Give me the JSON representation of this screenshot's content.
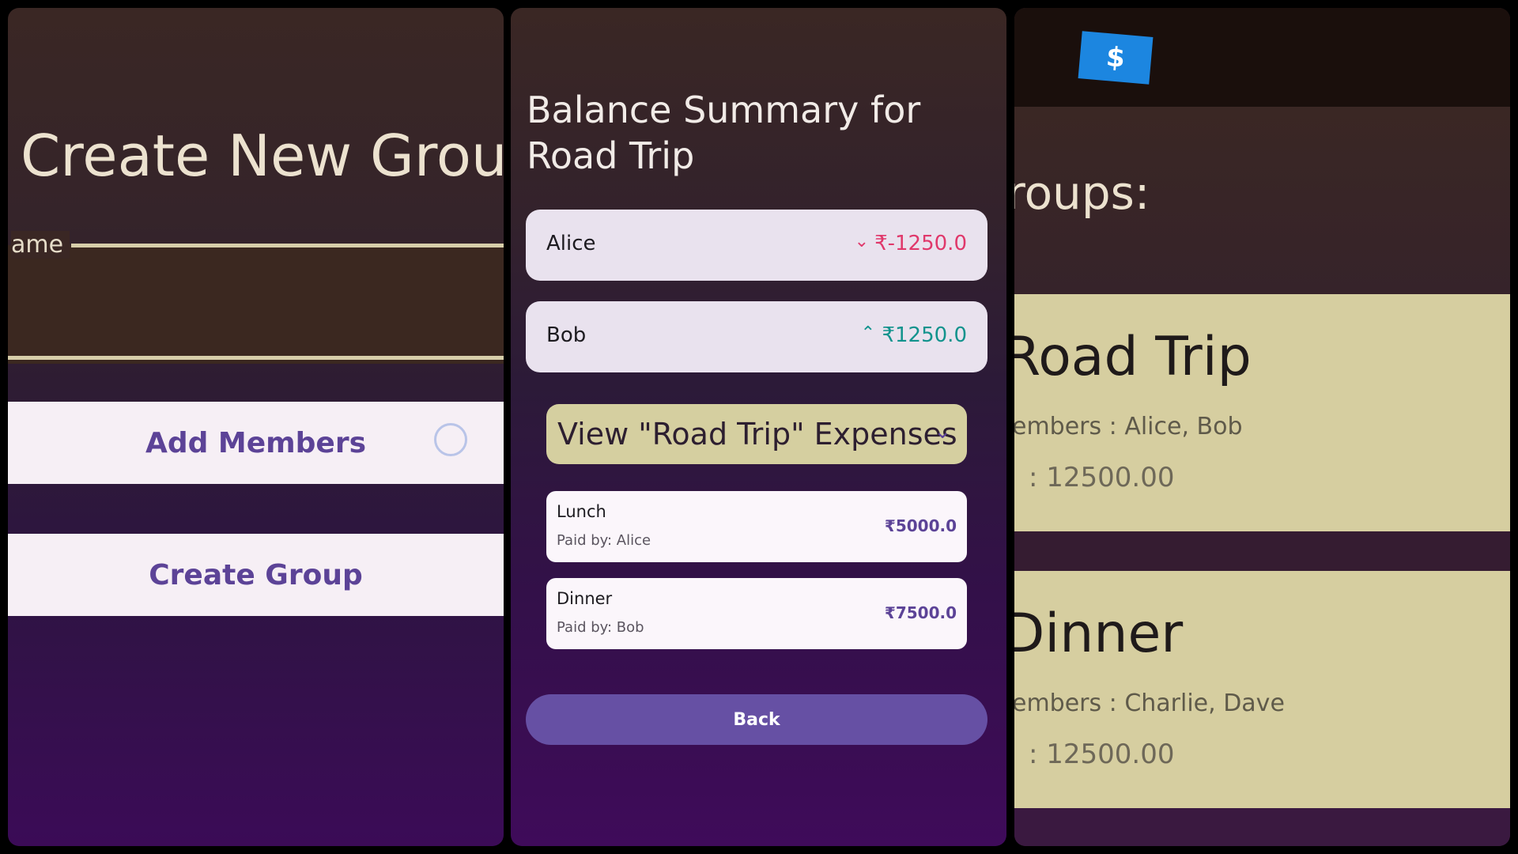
{
  "create_group": {
    "title": "Create New Group",
    "name_label": "ame",
    "add_members_label": "Add Members",
    "create_group_label": "Create Group"
  },
  "balance": {
    "title": "Balance Summary for Road Trip",
    "rows": [
      {
        "name": "Alice",
        "amount": "₹-1250.0",
        "chevron": "chevron-down-icon",
        "status_color": "#e0386b"
      },
      {
        "name": "Bob",
        "amount": "₹1250.0",
        "chevron": "chevron-up-icon",
        "status_color": "#12938d"
      }
    ],
    "view_expenses_label": "View \"Road Trip\" Expenses",
    "expenses": [
      {
        "name": "Lunch",
        "paid_by": "Paid by: Alice",
        "amount": "₹5000.0"
      },
      {
        "name": "Dinner",
        "paid_by": "Paid by: Bob",
        "amount": "₹7500.0"
      }
    ],
    "back_label": "Back"
  },
  "groups": {
    "logo_symbol": "$",
    "heading": "roups:",
    "items": [
      {
        "name": "Road Trip",
        "members": "embers : Alice, Bob",
        "total": ": 12500.00"
      },
      {
        "name": "Dinner",
        "members": "embers : Charlie, Dave",
        "total": ": 12500.00"
      }
    ]
  },
  "colors": {
    "accent": "#6650a4",
    "card_yellow": "#d6cea0",
    "negative": "#e0386b",
    "positive": "#12938d"
  }
}
